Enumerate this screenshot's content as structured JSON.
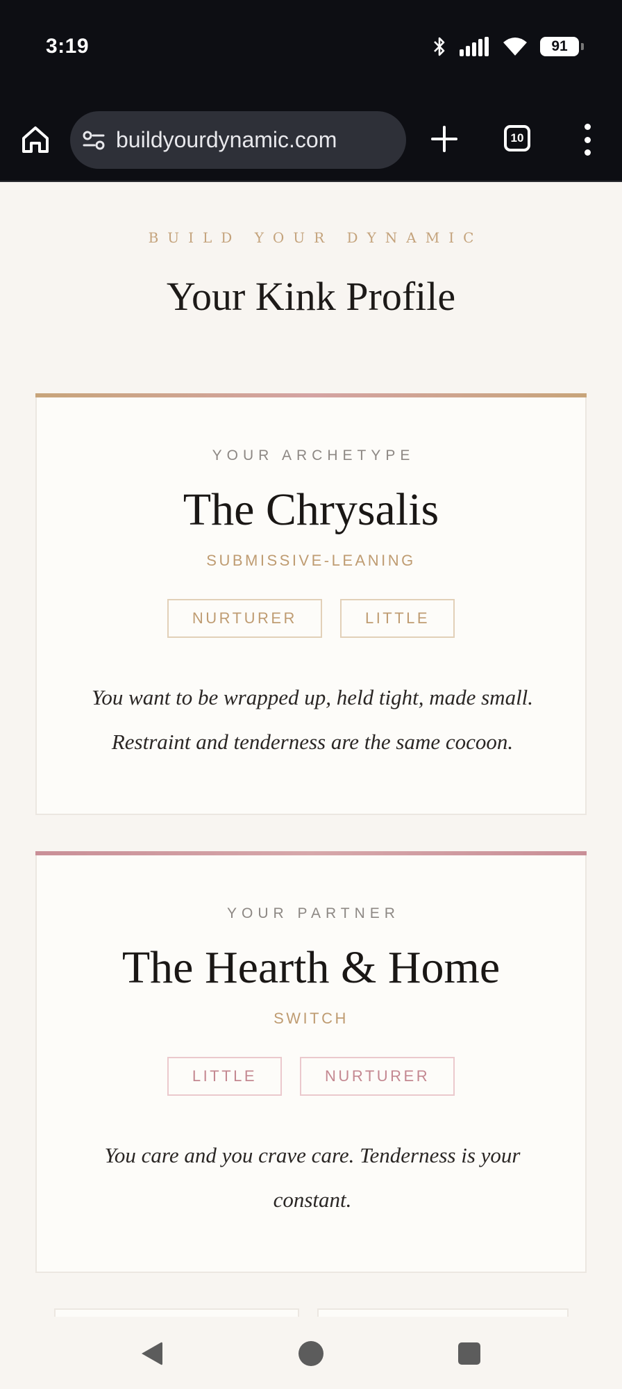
{
  "status_bar": {
    "time": "3:19",
    "battery": "91",
    "icons": [
      "bluetooth-icon",
      "signal-icon",
      "wifi-icon",
      "battery-icon"
    ]
  },
  "browser": {
    "url": "buildyourdynamic.com",
    "tab_count": "10",
    "icons": [
      "home-icon",
      "site-info-icon",
      "new-tab-icon",
      "tabs-icon",
      "more-menu-icon"
    ]
  },
  "page": {
    "kicker": "BUILD YOUR DYNAMIC",
    "title": "Your Kink Profile"
  },
  "archetype_card": {
    "label": "YOUR ARCHETYPE",
    "name": "The Chrysalis",
    "role": "SUBMISSIVE-LEANING",
    "tags": [
      "NURTURER",
      "LITTLE"
    ],
    "description": "You want to be wrapped up, held tight, made small. Restraint and tenderness are the same cocoon."
  },
  "partner_card": {
    "label": "YOUR PARTNER",
    "name": "The Hearth & Home",
    "role": "SWITCH",
    "tags": [
      "LITTLE",
      "NURTURER"
    ],
    "description": "You care and you crave care. Tenderness is your constant."
  },
  "colors": {
    "status_bg": "#0d0e13",
    "page_bg": "#f8f5f1",
    "gold_accent": "#bf9c72",
    "rose_accent": "#c48891",
    "text_dark": "#1a1715"
  },
  "nav_icons": [
    "back-icon",
    "home-circle-icon",
    "recents-icon"
  ]
}
